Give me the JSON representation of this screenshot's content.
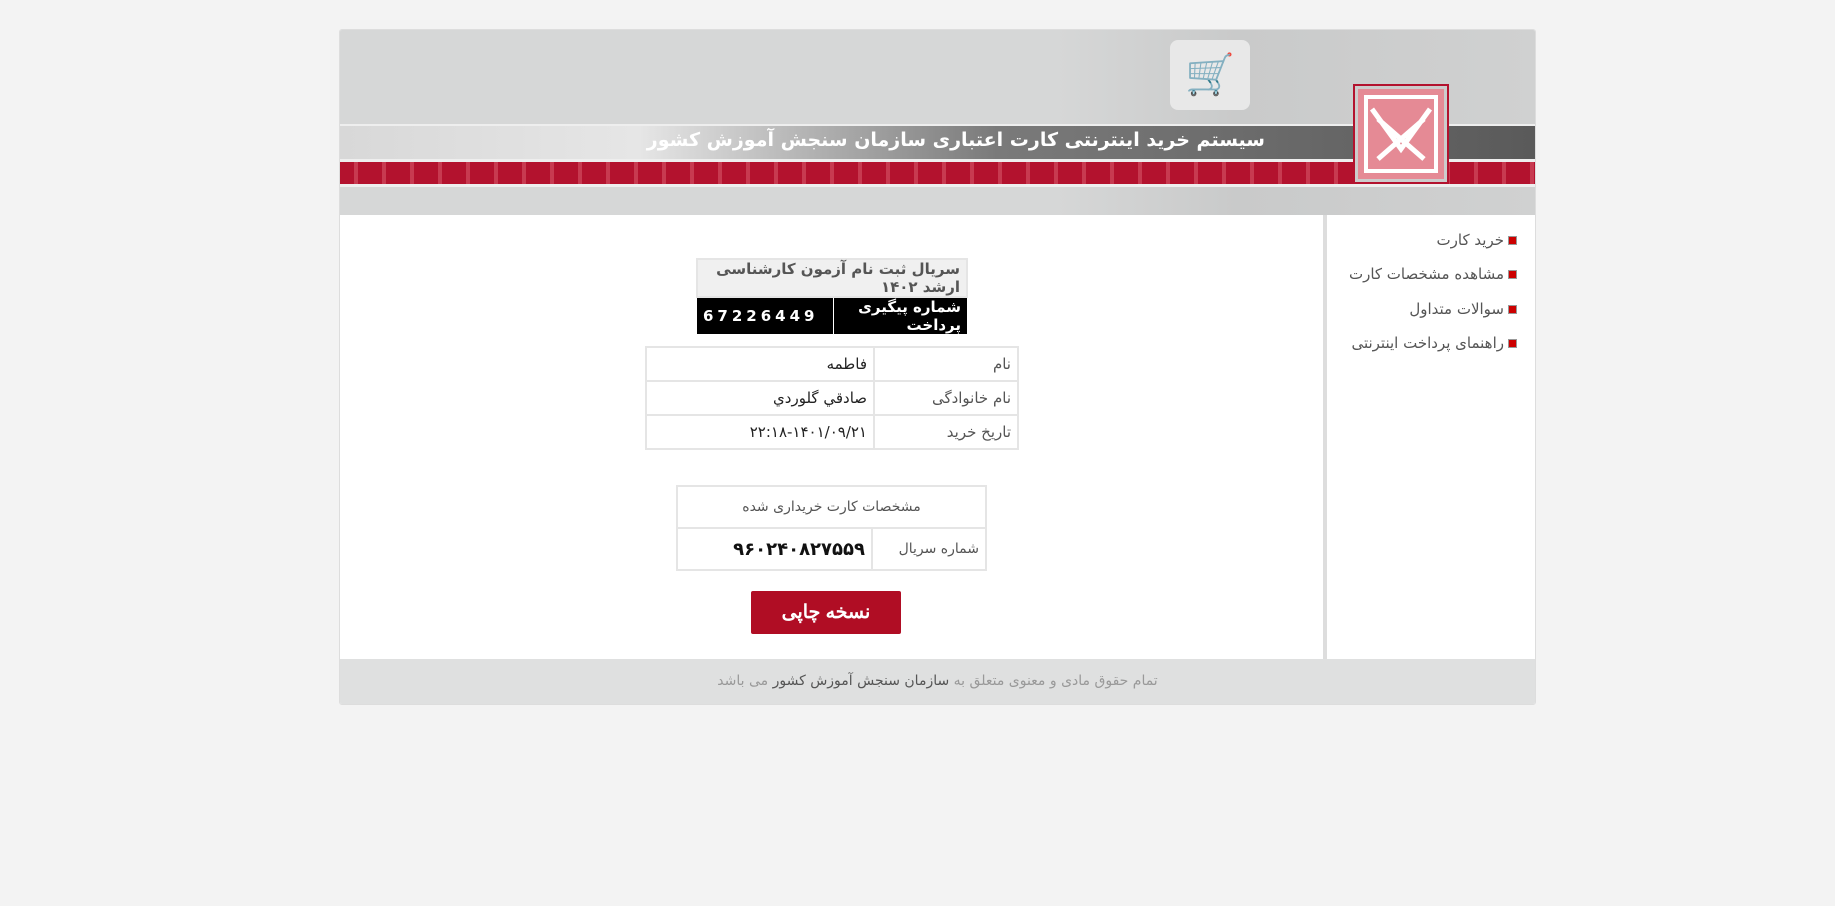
{
  "header": {
    "title": "سیستم خرید اینترنتی کارت اعتباری سازمان سنجش آموزش کشور",
    "logo_text": "سازمان سنجش آموزش کشور"
  },
  "sidebar": {
    "items": [
      {
        "label": "خرید کارت"
      },
      {
        "label": "مشاهده مشخصات کارت"
      },
      {
        "label": "سوالات متداول"
      },
      {
        "label": "راهنمای پرداخت اینترنتی"
      }
    ]
  },
  "main": {
    "product": "سریال ثبت نام آزمون کارشناسی ارشد ۱۴۰۲",
    "tracking_label": "شماره پیگیری پرداخت",
    "tracking_number": "67226449",
    "info": [
      {
        "label": "نام",
        "value": "فاطمه"
      },
      {
        "label": "نام خانوادگی",
        "value": "صادقي گلوردي"
      },
      {
        "label": "تاریخ خرید",
        "value": "۲۲:۱۸-۱۴۰۱/۰۹/۲۱"
      }
    ],
    "card_title": "مشخصات کارت خریداری شده",
    "serial_label": "شماره سریال",
    "serial_value": "۹۶۰۲۴۰۸۲۷۵۵۹",
    "print_label": "نسخه چاپی"
  },
  "footer": {
    "prefix": "تمام حقوق مادی و معنوی متعلق به",
    "org": "سازمان سنجش آموزش کشور",
    "suffix": "می باشد"
  },
  "colors": {
    "accent": "#b00d24",
    "background": "#f3f3f3"
  }
}
